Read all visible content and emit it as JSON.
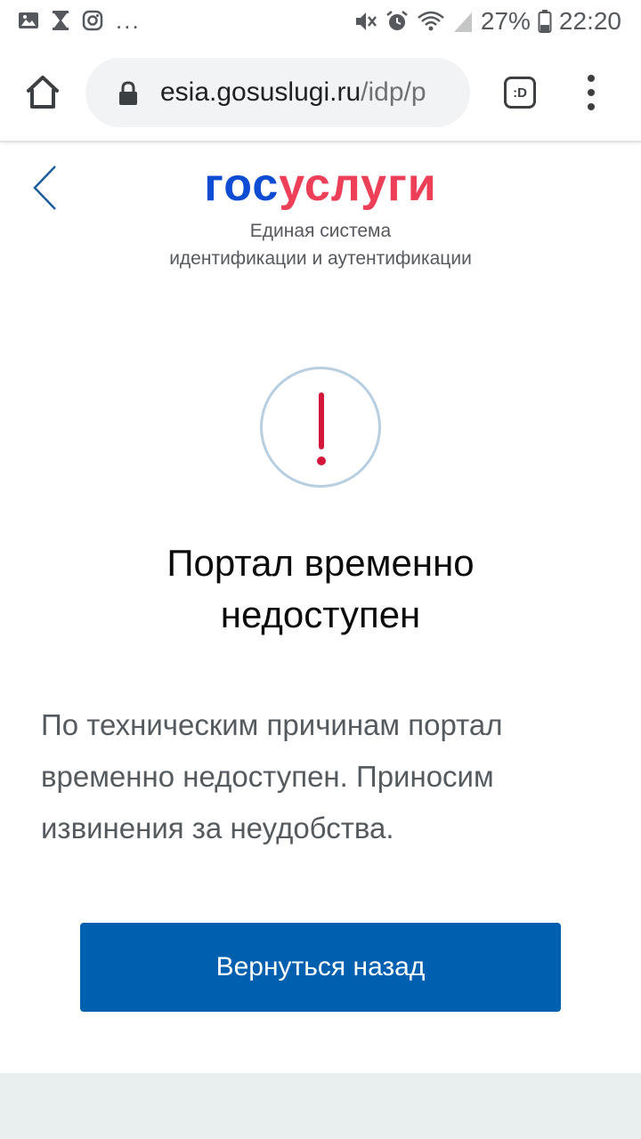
{
  "status_bar": {
    "more_indicator": "...",
    "battery_percent": "27%",
    "time": "22:20",
    "icons": [
      "image-icon",
      "hourglass-icon",
      "instagram-icon",
      "mute-icon",
      "alarm-icon",
      "wifi-icon",
      "signal-icon",
      "battery-icon"
    ]
  },
  "browser": {
    "url_host": "esia.gosuslugi.ru",
    "url_path": "/idp/p",
    "tab_switcher_label": ":D",
    "icons": [
      "home-icon",
      "lock-icon",
      "tab-switcher-icon",
      "more-vert-icon"
    ]
  },
  "page": {
    "logo": {
      "part_blue": "гос",
      "part_red": "услуги"
    },
    "subtitle_lines": [
      "Единая система",
      "идентификации и аутентификации"
    ],
    "heading_lines": [
      "Портал временно",
      "недоступен"
    ],
    "message_lines": [
      "По техническим причинам портал",
      "временно недоступен. Приносим",
      "извинения за неудобства."
    ],
    "back_button_label": "Вернуться назад"
  },
  "colors": {
    "logo_blue": "#0d4cd3",
    "logo_red": "#ee3f58",
    "button_blue": "#0060b0",
    "alert_red": "#d3173a",
    "alert_ring": "#b7cfe1",
    "footer_band": "#e9eeee"
  }
}
